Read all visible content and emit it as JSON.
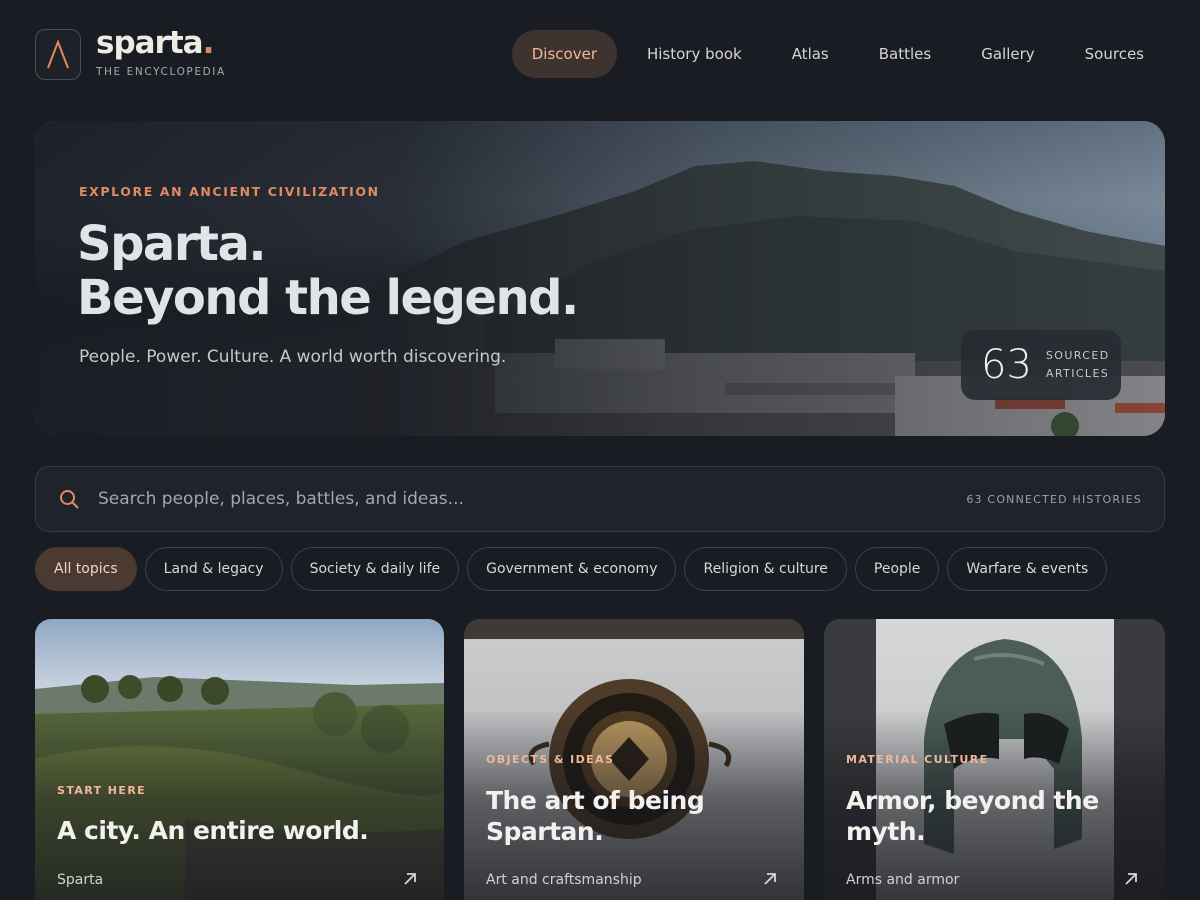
{
  "brand": {
    "name": "sparta",
    "dot": ".",
    "subtitle": "THE ENCYCLOPEDIA",
    "logo_icon": "lambda-icon"
  },
  "nav": {
    "items": [
      {
        "label": "Discover",
        "active": true
      },
      {
        "label": "History book",
        "active": false
      },
      {
        "label": "Atlas",
        "active": false
      },
      {
        "label": "Battles",
        "active": false
      },
      {
        "label": "Gallery",
        "active": false
      },
      {
        "label": "Sources",
        "active": false
      }
    ]
  },
  "hero": {
    "eyebrow": "EXPLORE AN ANCIENT CIVILIZATION",
    "title_line1": "Sparta.",
    "title_line2": "Beyond the legend.",
    "subtitle": "People. Power. Culture. A world worth discovering.",
    "stat_number": "63",
    "stat_label_line1": "SOURCED",
    "stat_label_line2": "ARTICLES"
  },
  "search": {
    "placeholder": "Search people, places, battles, and ideas...",
    "count_label": "63 CONNECTED HISTORIES",
    "icon": "search-icon"
  },
  "chips": [
    {
      "label": "All topics",
      "active": true
    },
    {
      "label": "Land & legacy",
      "active": false
    },
    {
      "label": "Society & daily life",
      "active": false
    },
    {
      "label": "Government & economy",
      "active": false
    },
    {
      "label": "Religion & culture",
      "active": false
    },
    {
      "label": "People",
      "active": false
    },
    {
      "label": "Warfare & events",
      "active": false
    }
  ],
  "cards": [
    {
      "eyebrow": "START HERE",
      "title": "A city. An entire world.",
      "tag": "Sparta",
      "icon": "arrow-up-right-icon"
    },
    {
      "eyebrow": "OBJECTS & IDEAS",
      "title": "The art of being Spartan.",
      "tag": "Art and craftsmanship",
      "icon": "arrow-up-right-icon"
    },
    {
      "eyebrow": "MATERIAL CULTURE",
      "title": "Armor, beyond the myth.",
      "tag": "Arms and armor",
      "icon": "arrow-up-right-icon"
    }
  ],
  "colors": {
    "accent": "#e08a62",
    "background": "#191c23",
    "active_chip": "#4a3a32"
  }
}
